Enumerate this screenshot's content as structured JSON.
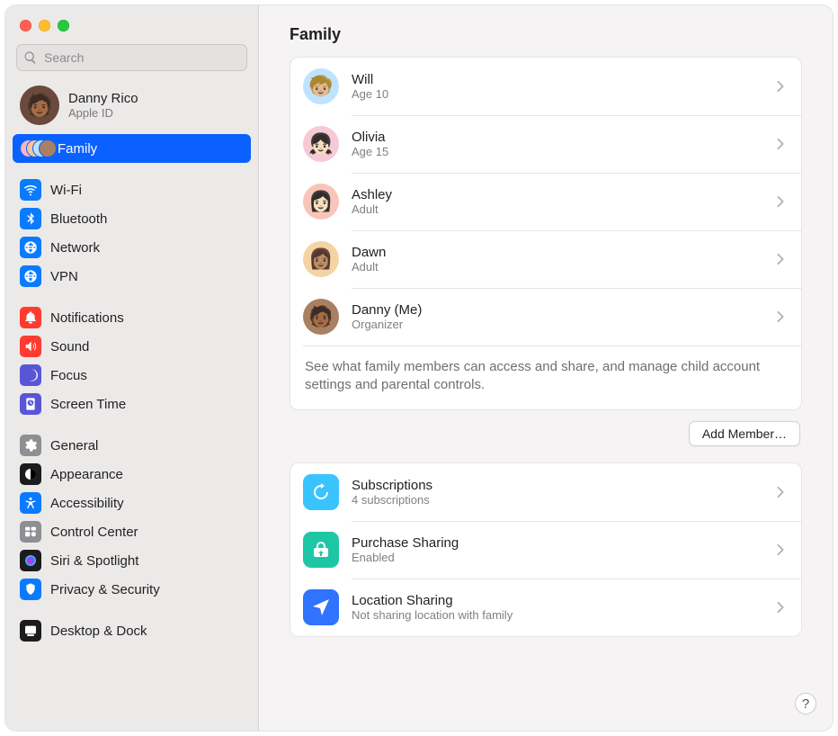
{
  "search": {
    "placeholder": "Search"
  },
  "account": {
    "name": "Danny Rico",
    "subtitle": "Apple ID"
  },
  "sidebar": {
    "family_label": "Family",
    "items": [
      {
        "label": "Wi-Fi",
        "color": "#0a7bff"
      },
      {
        "label": "Bluetooth",
        "color": "#0a7bff"
      },
      {
        "label": "Network",
        "color": "#0a7bff"
      },
      {
        "label": "VPN",
        "color": "#0a7bff"
      },
      {
        "label": "Notifications",
        "color": "#ff3b30"
      },
      {
        "label": "Sound",
        "color": "#ff3b30"
      },
      {
        "label": "Focus",
        "color": "#5856d6"
      },
      {
        "label": "Screen Time",
        "color": "#5856d6"
      },
      {
        "label": "General",
        "color": "#8e8e93"
      },
      {
        "label": "Appearance",
        "color": "#1c1c1e"
      },
      {
        "label": "Accessibility",
        "color": "#0a7bff"
      },
      {
        "label": "Control Center",
        "color": "#8e8e93"
      },
      {
        "label": "Siri & Spotlight",
        "color": "#1c1c1e"
      },
      {
        "label": "Privacy & Security",
        "color": "#0a7bff"
      },
      {
        "label": "Desktop & Dock",
        "color": "#1c1c1e"
      }
    ]
  },
  "page": {
    "title": "Family"
  },
  "members": [
    {
      "name": "Will",
      "sub": "Age 10",
      "bg": "#bfe3ff"
    },
    {
      "name": "Olivia",
      "sub": "Age 15",
      "bg": "#f6c9d7"
    },
    {
      "name": "Ashley",
      "sub": "Adult",
      "bg": "#f8c6b8"
    },
    {
      "name": "Dawn",
      "sub": "Adult",
      "bg": "#f4d4a4"
    },
    {
      "name": "Danny (Me)",
      "sub": "Organizer",
      "bg": "#a98062"
    }
  ],
  "members_footer": "See what family members can access and share, and manage child account settings and parental controls.",
  "add_member_label": "Add Member…",
  "features": [
    {
      "name": "Subscriptions",
      "sub": "4 subscriptions",
      "color": "#39c3ff"
    },
    {
      "name": "Purchase Sharing",
      "sub": "Enabled",
      "color": "#1fc6a6"
    },
    {
      "name": "Location Sharing",
      "sub": "Not sharing location with family",
      "color": "#2f73ff"
    }
  ],
  "help_label": "?"
}
